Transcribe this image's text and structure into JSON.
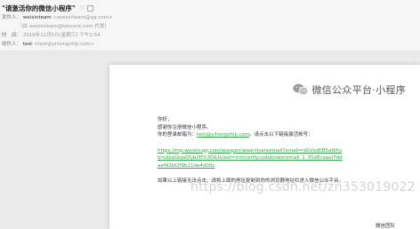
{
  "email": {
    "subject": "\"请激活你的微信小程序\"",
    "from_label": "发件人：",
    "from_name": "weixinteam",
    "from_addr": "<weixinteam@qq.com>",
    "proxy_line": "（由 weixinteam@tencent.com 代发）",
    "time_label": "时　间：",
    "time_value": "2019年11月5日(星期三) 下午2:54",
    "to_label": "收件人：",
    "to_name": "test",
    "to_addr": "<test@yihongshiji.com>"
  },
  "card": {
    "brand": "微信公众平台·小程序",
    "greeting": "你好，",
    "thanks": "感谢你注册微信小程序。",
    "login_prefix": "你的登录邮箱为：",
    "login_email": "test@yihongshiji.com",
    "login_suffix": "。请点击以下链接激活帐号：",
    "activation_link": "https://mp.weixin.qq.com/wxopen/waactivateemail?email=dGVzdEB5aWhvbmdzaGlqaS5jb20%3D&ticket=mmverifycodebrokeremail_1_35d8caaeI7ddaef42bf2f9b21de4d00c",
    "fallback": "如果以上链接无法点击，请将上面的地址复制到你的浏览器地址栏进入微信公众平台。",
    "signoff": "微信团队"
  },
  "watermark": "https://blog.csdn.net/zn353019022"
}
